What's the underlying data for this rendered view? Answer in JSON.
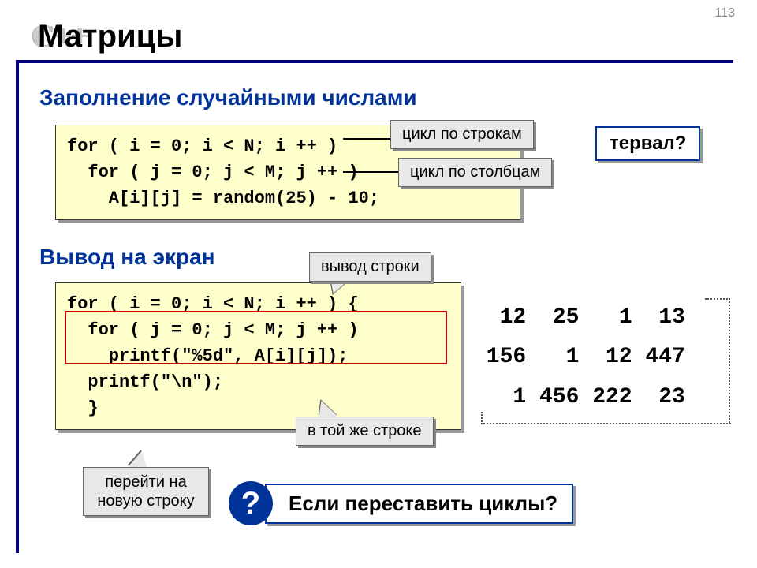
{
  "page_number": "113",
  "logo": "C++",
  "title": "Матрицы",
  "section1": "Заполнение случайными числами",
  "section2": "Вывод на экран",
  "code1": "for ( i = 0; i < N; i ++ )\n  for ( j = 0; j < M; j ++ )\n    A[i][j] = random(25) - 10;",
  "code2": "for ( i = 0; i < N; i ++ ) {\n  for ( j = 0; j < M; j ++ )\n    printf(\"%5d\", A[i][j]);\n  printf(\"\\n\");\n  }",
  "labels": {
    "rows": "цикл по строкам",
    "cols": "цикл по столбцам",
    "rowout": "вывод строки",
    "sameline": "в той же строке",
    "newline": "перейти на новую строку"
  },
  "interval_q": "тервал?",
  "qmark": "?",
  "question": "Если переставить циклы?",
  "matrix": "  12  25   1  13\n 156   1  12 447\n   1 456 222  23"
}
